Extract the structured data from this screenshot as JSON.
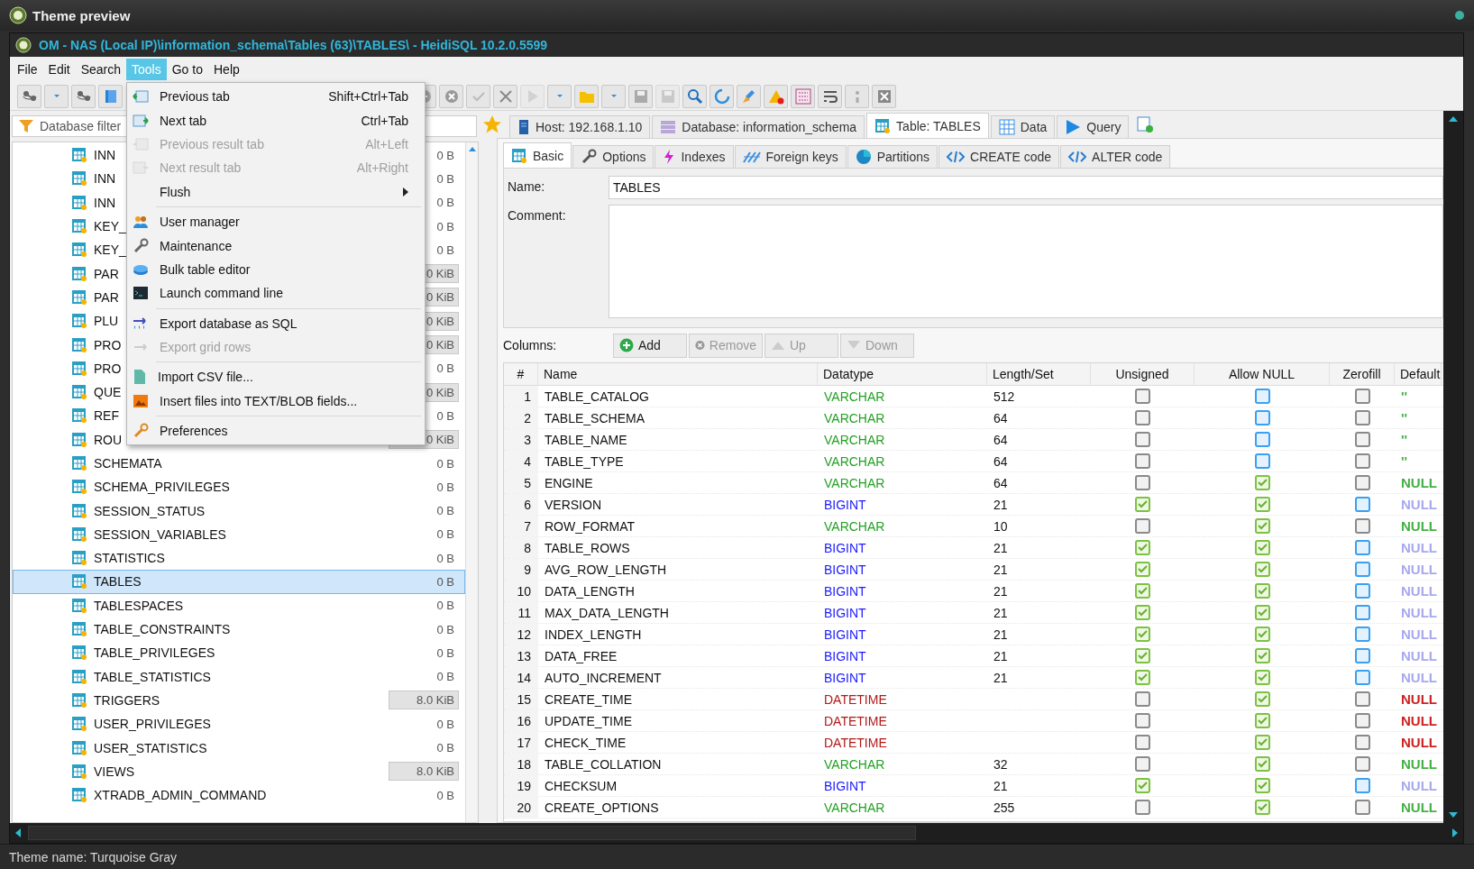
{
  "outer_title": "Theme preview",
  "window_title": "OM - NAS (Local IP)\\information_schema\\Tables (63)\\TABLES\\ - HeidiSQL 10.2.0.5599",
  "menubar": [
    {
      "label": "File",
      "selected": false
    },
    {
      "label": "Edit",
      "selected": false
    },
    {
      "label": "Search",
      "selected": false
    },
    {
      "label": "Tools",
      "selected": true
    },
    {
      "label": "Go to",
      "selected": false
    },
    {
      "label": "Help",
      "selected": false
    }
  ],
  "menu": {
    "groups": [
      [
        {
          "label": "Previous tab",
          "shortcut": "Shift+Ctrl+Tab",
          "disabled": false
        },
        {
          "label": "Next tab",
          "shortcut": "Ctrl+Tab",
          "disabled": false
        },
        {
          "label": "Previous result tab",
          "shortcut": "Alt+Left",
          "disabled": true
        },
        {
          "label": "Next result tab",
          "shortcut": "Alt+Right",
          "disabled": true
        },
        {
          "label": "Flush",
          "disabled": false,
          "submenu": true
        }
      ],
      [
        {
          "label": "User manager",
          "disabled": false
        },
        {
          "label": "Maintenance",
          "disabled": false
        },
        {
          "label": "Bulk table editor",
          "disabled": false
        },
        {
          "label": "Launch command line",
          "disabled": false
        }
      ],
      [
        {
          "label": "Export database as SQL",
          "disabled": false
        },
        {
          "label": "Export grid rows",
          "disabled": true
        }
      ],
      [
        {
          "label": "Import CSV file...",
          "disabled": false
        },
        {
          "label": "Insert files into TEXT/BLOB fields...",
          "disabled": false
        }
      ],
      [
        {
          "label": "Preferences",
          "disabled": false
        }
      ]
    ]
  },
  "filter": {
    "placeholder": "Database filter"
  },
  "tree": [
    {
      "name": "INN",
      "size": "0 B",
      "kind": "plain",
      "selected": false
    },
    {
      "name": "INN",
      "size": "0 B",
      "kind": "plain",
      "selected": false
    },
    {
      "name": "INN",
      "size": "0 B",
      "kind": "plain",
      "selected": false
    },
    {
      "name": "KEY_",
      "size": "0 B",
      "kind": "plain",
      "selected": false
    },
    {
      "name": "KEY_",
      "size": "0 B",
      "kind": "plain",
      "selected": false
    },
    {
      "name": "PAR",
      "size": "0 KiB",
      "kind": "bar",
      "selected": false
    },
    {
      "name": "PAR",
      "size": "0 KiB",
      "kind": "bar",
      "selected": false
    },
    {
      "name": "PLU",
      "size": "0 KiB",
      "kind": "bar",
      "selected": false
    },
    {
      "name": "PRO",
      "size": "0 KiB",
      "kind": "bar",
      "selected": false
    },
    {
      "name": "PRO",
      "size": "0 B",
      "kind": "plain",
      "selected": false
    },
    {
      "name": "QUE",
      "size": "0 KiB",
      "kind": "bar",
      "selected": false
    },
    {
      "name": "REF",
      "size": "0 B",
      "kind": "plain",
      "selected": false
    },
    {
      "name": "ROU",
      "size": "0 KiB",
      "kind": "bar",
      "selected": false
    },
    {
      "name": "SCHEMATA",
      "size": "0 B",
      "kind": "plain",
      "selected": false
    },
    {
      "name": "SCHEMA_PRIVILEGES",
      "size": "0 B",
      "kind": "plain",
      "selected": false
    },
    {
      "name": "SESSION_STATUS",
      "size": "0 B",
      "kind": "plain",
      "selected": false
    },
    {
      "name": "SESSION_VARIABLES",
      "size": "0 B",
      "kind": "plain",
      "selected": false
    },
    {
      "name": "STATISTICS",
      "size": "0 B",
      "kind": "plain",
      "selected": false
    },
    {
      "name": "TABLES",
      "size": "0 B",
      "kind": "plain",
      "selected": true
    },
    {
      "name": "TABLESPACES",
      "size": "0 B",
      "kind": "plain",
      "selected": false
    },
    {
      "name": "TABLE_CONSTRAINTS",
      "size": "0 B",
      "kind": "plain",
      "selected": false
    },
    {
      "name": "TABLE_PRIVILEGES",
      "size": "0 B",
      "kind": "plain",
      "selected": false
    },
    {
      "name": "TABLE_STATISTICS",
      "size": "0 B",
      "kind": "plain",
      "selected": false
    },
    {
      "name": "TRIGGERS",
      "size": "8.0 KiB",
      "kind": "bar",
      "selected": false
    },
    {
      "name": "USER_PRIVILEGES",
      "size": "0 B",
      "kind": "plain",
      "selected": false
    },
    {
      "name": "USER_STATISTICS",
      "size": "0 B",
      "kind": "plain",
      "selected": false
    },
    {
      "name": "VIEWS",
      "size": "8.0 KiB",
      "kind": "bar",
      "selected": false
    },
    {
      "name": "XTRADB_ADMIN_COMMAND",
      "size": "0 B",
      "kind": "plain",
      "selected": false
    }
  ],
  "tabs": [
    {
      "label": "Host: 192.168.1.10",
      "selected": false
    },
    {
      "label": "Database: information_schema",
      "selected": false
    },
    {
      "label": "Table: TABLES",
      "selected": true
    },
    {
      "label": "Data",
      "selected": false
    },
    {
      "label": "Query",
      "selected": false
    }
  ],
  "subtabs": [
    {
      "label": "Basic",
      "selected": true
    },
    {
      "label": "Options",
      "selected": false
    },
    {
      "label": "Indexes",
      "selected": false
    },
    {
      "label": "Foreign keys",
      "selected": false
    },
    {
      "label": "Partitions",
      "selected": false
    },
    {
      "label": "CREATE code",
      "selected": false
    },
    {
      "label": "ALTER code",
      "selected": false
    }
  ],
  "name_label": "Name:",
  "name_value": "TABLES",
  "comment_label": "Comment:",
  "columns_label": "Columns:",
  "column_buttons": [
    {
      "label": "Add",
      "disabled": false
    },
    {
      "label": "Remove",
      "disabled": true
    },
    {
      "label": "Up",
      "disabled": true
    },
    {
      "label": "Down",
      "disabled": true
    }
  ],
  "table": {
    "columns": [
      "#",
      "Name",
      "Datatype",
      "Length/Set",
      "Unsigned",
      "Allow NULL",
      "Zerofill",
      "Default"
    ],
    "rows": [
      {
        "n": "1",
        "name": "TABLE_CATALOG",
        "datatype": {
          "text": "VARCHAR",
          "color": "#22a022"
        },
        "length": "512",
        "unsigned": {
          "checked": false,
          "disabled": true
        },
        "allow_null": {
          "checked": false,
          "disabled": false
        },
        "zerofill": {
          "checked": false,
          "disabled": true
        },
        "default": {
          "text": "''",
          "color": "#44b044"
        }
      },
      {
        "n": "2",
        "name": "TABLE_SCHEMA",
        "datatype": {
          "text": "VARCHAR",
          "color": "#22a022"
        },
        "length": "64",
        "unsigned": {
          "checked": false,
          "disabled": true
        },
        "allow_null": {
          "checked": false,
          "disabled": false
        },
        "zerofill": {
          "checked": false,
          "disabled": true
        },
        "default": {
          "text": "''",
          "color": "#44b044"
        }
      },
      {
        "n": "3",
        "name": "TABLE_NAME",
        "datatype": {
          "text": "VARCHAR",
          "color": "#22a022"
        },
        "length": "64",
        "unsigned": {
          "checked": false,
          "disabled": true
        },
        "allow_null": {
          "checked": false,
          "disabled": false
        },
        "zerofill": {
          "checked": false,
          "disabled": true
        },
        "default": {
          "text": "''",
          "color": "#44b044"
        }
      },
      {
        "n": "4",
        "name": "TABLE_TYPE",
        "datatype": {
          "text": "VARCHAR",
          "color": "#22a022"
        },
        "length": "64",
        "unsigned": {
          "checked": false,
          "disabled": true
        },
        "allow_null": {
          "checked": false,
          "disabled": false
        },
        "zerofill": {
          "checked": false,
          "disabled": true
        },
        "default": {
          "text": "''",
          "color": "#44b044"
        }
      },
      {
        "n": "5",
        "name": "ENGINE",
        "datatype": {
          "text": "VARCHAR",
          "color": "#22a022"
        },
        "length": "64",
        "unsigned": {
          "checked": false,
          "disabled": true
        },
        "allow_null": {
          "checked": true,
          "disabled": false
        },
        "zerofill": {
          "checked": false,
          "disabled": true
        },
        "default": {
          "text": "NULL",
          "color": "#44b044"
        }
      },
      {
        "n": "6",
        "name": "VERSION",
        "datatype": {
          "text": "BIGINT",
          "color": "#1a1aff"
        },
        "length": "21",
        "unsigned": {
          "checked": true,
          "disabled": false
        },
        "allow_null": {
          "checked": true,
          "disabled": false
        },
        "zerofill": {
          "checked": false,
          "disabled": false
        },
        "default": {
          "text": "NULL",
          "color": "#a8a8ee"
        }
      },
      {
        "n": "7",
        "name": "ROW_FORMAT",
        "datatype": {
          "text": "VARCHAR",
          "color": "#22a022"
        },
        "length": "10",
        "unsigned": {
          "checked": false,
          "disabled": true
        },
        "allow_null": {
          "checked": true,
          "disabled": false
        },
        "zerofill": {
          "checked": false,
          "disabled": true
        },
        "default": {
          "text": "NULL",
          "color": "#44b044"
        }
      },
      {
        "n": "8",
        "name": "TABLE_ROWS",
        "datatype": {
          "text": "BIGINT",
          "color": "#1a1aff"
        },
        "length": "21",
        "unsigned": {
          "checked": true,
          "disabled": false
        },
        "allow_null": {
          "checked": true,
          "disabled": false
        },
        "zerofill": {
          "checked": false,
          "disabled": false
        },
        "default": {
          "text": "NULL",
          "color": "#a8a8ee"
        }
      },
      {
        "n": "9",
        "name": "AVG_ROW_LENGTH",
        "datatype": {
          "text": "BIGINT",
          "color": "#1a1aff"
        },
        "length": "21",
        "unsigned": {
          "checked": true,
          "disabled": false
        },
        "allow_null": {
          "checked": true,
          "disabled": false
        },
        "zerofill": {
          "checked": false,
          "disabled": false
        },
        "default": {
          "text": "NULL",
          "color": "#a8a8ee"
        }
      },
      {
        "n": "10",
        "name": "DATA_LENGTH",
        "datatype": {
          "text": "BIGINT",
          "color": "#1a1aff"
        },
        "length": "21",
        "unsigned": {
          "checked": true,
          "disabled": false
        },
        "allow_null": {
          "checked": true,
          "disabled": false
        },
        "zerofill": {
          "checked": false,
          "disabled": false
        },
        "default": {
          "text": "NULL",
          "color": "#a8a8ee"
        }
      },
      {
        "n": "11",
        "name": "MAX_DATA_LENGTH",
        "datatype": {
          "text": "BIGINT",
          "color": "#1a1aff"
        },
        "length": "21",
        "unsigned": {
          "checked": true,
          "disabled": false
        },
        "allow_null": {
          "checked": true,
          "disabled": false
        },
        "zerofill": {
          "checked": false,
          "disabled": false
        },
        "default": {
          "text": "NULL",
          "color": "#a8a8ee"
        }
      },
      {
        "n": "12",
        "name": "INDEX_LENGTH",
        "datatype": {
          "text": "BIGINT",
          "color": "#1a1aff"
        },
        "length": "21",
        "unsigned": {
          "checked": true,
          "disabled": false
        },
        "allow_null": {
          "checked": true,
          "disabled": false
        },
        "zerofill": {
          "checked": false,
          "disabled": false
        },
        "default": {
          "text": "NULL",
          "color": "#a8a8ee"
        }
      },
      {
        "n": "13",
        "name": "DATA_FREE",
        "datatype": {
          "text": "BIGINT",
          "color": "#1a1aff"
        },
        "length": "21",
        "unsigned": {
          "checked": true,
          "disabled": false
        },
        "allow_null": {
          "checked": true,
          "disabled": false
        },
        "zerofill": {
          "checked": false,
          "disabled": false
        },
        "default": {
          "text": "NULL",
          "color": "#a8a8ee"
        }
      },
      {
        "n": "14",
        "name": "AUTO_INCREMENT",
        "datatype": {
          "text": "BIGINT",
          "color": "#1a1aff"
        },
        "length": "21",
        "unsigned": {
          "checked": true,
          "disabled": false
        },
        "allow_null": {
          "checked": true,
          "disabled": false
        },
        "zerofill": {
          "checked": false,
          "disabled": false
        },
        "default": {
          "text": "NULL",
          "color": "#a8a8ee"
        }
      },
      {
        "n": "15",
        "name": "CREATE_TIME",
        "datatype": {
          "text": "DATETIME",
          "color": "#b01818"
        },
        "unsigned": {
          "checked": false,
          "disabled": true
        },
        "allow_null": {
          "checked": true,
          "disabled": false
        },
        "zerofill": {
          "checked": false,
          "disabled": true
        },
        "default": {
          "text": "NULL",
          "color": "#d02020"
        }
      },
      {
        "n": "16",
        "name": "UPDATE_TIME",
        "datatype": {
          "text": "DATETIME",
          "color": "#b01818"
        },
        "unsigned": {
          "checked": false,
          "disabled": true
        },
        "allow_null": {
          "checked": true,
          "disabled": false
        },
        "zerofill": {
          "checked": false,
          "disabled": true
        },
        "default": {
          "text": "NULL",
          "color": "#d02020"
        }
      },
      {
        "n": "17",
        "name": "CHECK_TIME",
        "datatype": {
          "text": "DATETIME",
          "color": "#b01818"
        },
        "unsigned": {
          "checked": false,
          "disabled": true
        },
        "allow_null": {
          "checked": true,
          "disabled": false
        },
        "zerofill": {
          "checked": false,
          "disabled": true
        },
        "default": {
          "text": "NULL",
          "color": "#d02020"
        }
      },
      {
        "n": "18",
        "name": "TABLE_COLLATION",
        "datatype": {
          "text": "VARCHAR",
          "color": "#22a022"
        },
        "length": "32",
        "unsigned": {
          "checked": false,
          "disabled": true
        },
        "allow_null": {
          "checked": true,
          "disabled": false
        },
        "zerofill": {
          "checked": false,
          "disabled": true
        },
        "default": {
          "text": "NULL",
          "color": "#44b044"
        }
      },
      {
        "n": "19",
        "name": "CHECKSUM",
        "datatype": {
          "text": "BIGINT",
          "color": "#1a1aff"
        },
        "length": "21",
        "unsigned": {
          "checked": true,
          "disabled": false
        },
        "allow_null": {
          "checked": true,
          "disabled": false
        },
        "zerofill": {
          "checked": false,
          "disabled": false
        },
        "default": {
          "text": "NULL",
          "color": "#a8a8ee"
        }
      },
      {
        "n": "20",
        "name": "CREATE_OPTIONS",
        "datatype": {
          "text": "VARCHAR",
          "color": "#22a022"
        },
        "length": "255",
        "unsigned": {
          "checked": false,
          "disabled": true
        },
        "allow_null": {
          "checked": true,
          "disabled": false
        },
        "zerofill": {
          "checked": false,
          "disabled": true
        },
        "default": {
          "text": "NULL",
          "color": "#44b044"
        }
      }
    ]
  },
  "status": "Theme name: Turquoise Gray"
}
